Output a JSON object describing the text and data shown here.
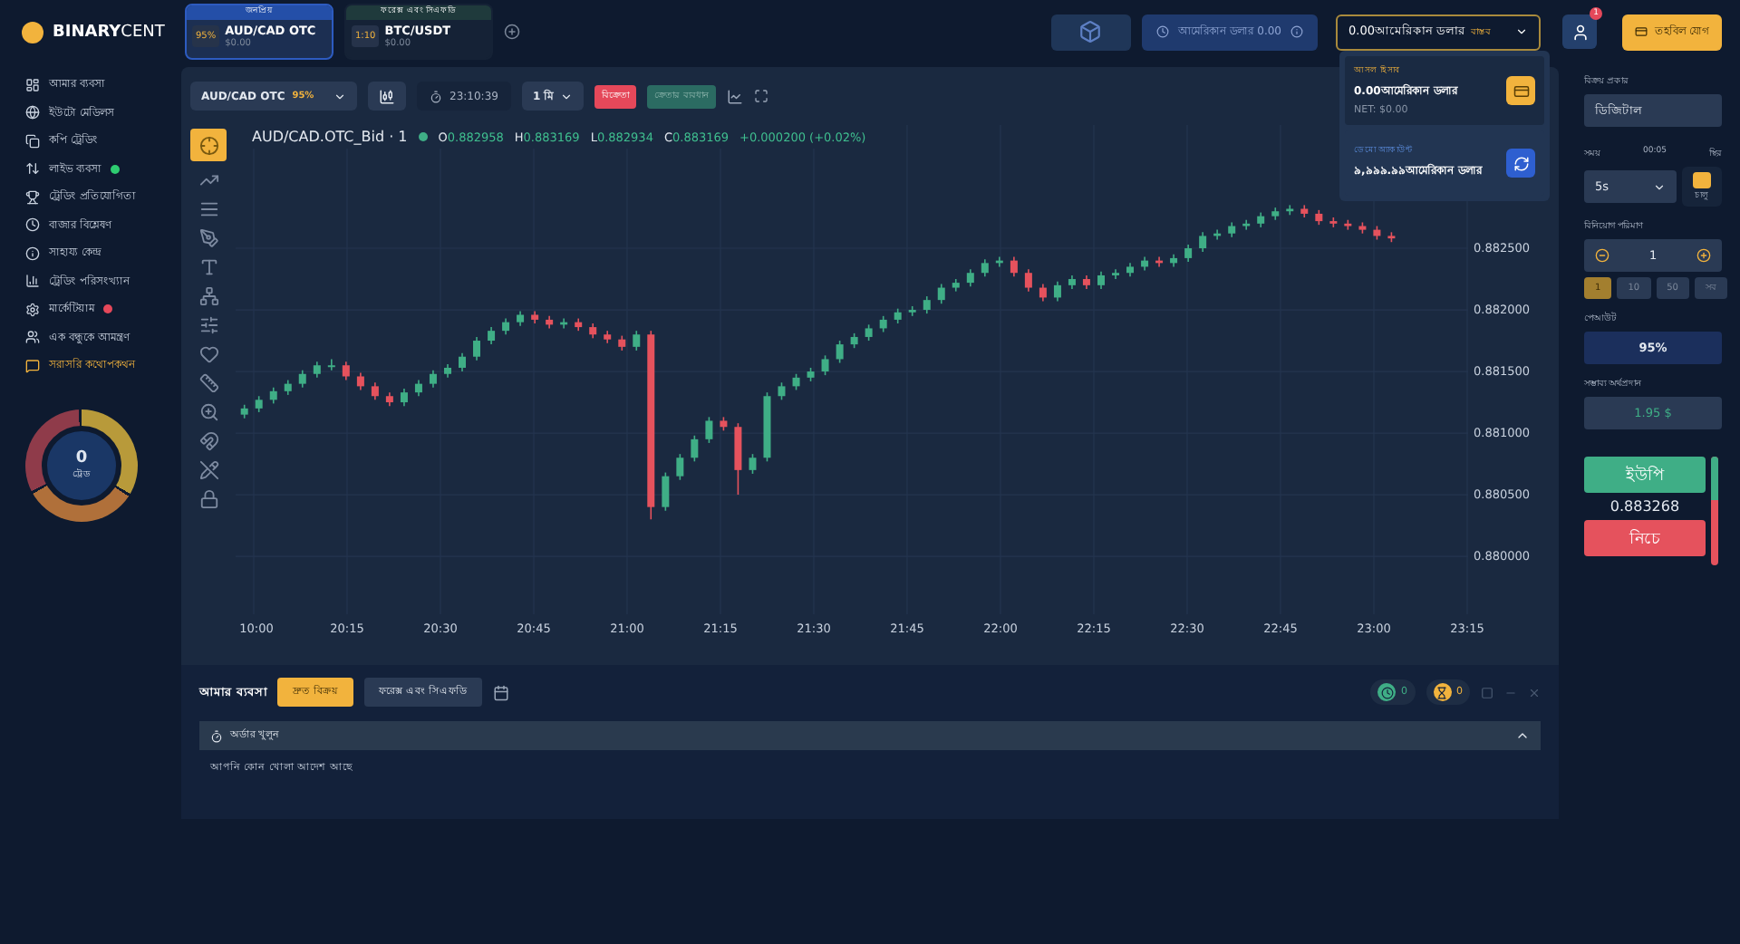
{
  "brand": {
    "bold": "BINARY",
    "light": "CENT"
  },
  "asset_tabs": [
    {
      "heading": "জনপ্রিয়",
      "badge": "95%",
      "symbol": "AUD/CAD OTC",
      "amount": "$0.00",
      "selected": true
    },
    {
      "heading": "ফরেক্স এবং সিএফডি",
      "badge": "1:10",
      "symbol": "BTC/USDT",
      "amount": "$0.00",
      "selected": false
    }
  ],
  "header": {
    "promo_balance": "আমেরিকান ডলার 0.00",
    "account_balance": "0.00আমেরিকান ডলার",
    "account_type": "বাস্তব",
    "notification_count": "1",
    "deposit": "তহবিল যোগ"
  },
  "account_menu": [
    {
      "kind": "real",
      "label": "আসল হিসাব",
      "balance": "0.00আমেরিকান ডলার",
      "net": "NET: $0.00"
    },
    {
      "kind": "demo",
      "label": "ডেমো অ্যাকাউন্ট",
      "balance": "৯,৯৯৯.৯৯আমেরিকান ডলার"
    }
  ],
  "sidebar": {
    "items": [
      {
        "label": "আমার ব্যবসা",
        "selected": false
      },
      {
        "label": "ইউটো মেডিলস",
        "selected": false
      },
      {
        "label": "কপি ট্রেডিং",
        "selected": false
      },
      {
        "label": "লাইভ ব্যবসা",
        "selected": false,
        "color": "#2ecc71"
      },
      {
        "label": "ট্রেডিং প্রতিযোগিতা",
        "selected": false
      },
      {
        "label": "বাজার বিশ্লেষণ",
        "selected": false
      },
      {
        "label": "সাহায্য কেন্দ্র",
        "selected": false
      },
      {
        "label": "ট্রেডিং পরিসংখ্যান",
        "selected": false
      },
      {
        "label": "মার্কেটিয়াম",
        "selected": false,
        "color": "#e5485a"
      },
      {
        "label": "এক বন্ধুকে আমন্ত্রণ",
        "selected": false
      },
      {
        "label": "সরাসরি কথোপকথন",
        "selected": true
      }
    ]
  },
  "wallet": {
    "count": "0",
    "label": "ট্রেড"
  },
  "chart_toolbar": {
    "asset": "AUD/CAD OTC",
    "payout": "95%",
    "time": "23:10:39",
    "interval": "1 মি",
    "sell": "বিক্রেতা",
    "buy": "ক্রেতার ব্যবধান"
  },
  "chart": {
    "title": "AUD/CAD.OTC_Bid · 1",
    "ohlc": [
      {
        "key": "O",
        "value": "0.882958"
      },
      {
        "key": "H",
        "value": "0.883169"
      },
      {
        "key": "L",
        "value": "0.882934"
      },
      {
        "key": "C",
        "value": "0.883169"
      }
    ],
    "change": "+0.000200 (+0.02%)",
    "x_edge_label": "10:00",
    "chart_data": {
      "type": "candlestick",
      "grid": true,
      "ylim": [
        0.87953,
        0.8835
      ],
      "xlim": [
        1197.09,
        1395.15
      ],
      "yticks": [
        {
          "value": 0.8825,
          "label": "0.882500"
        },
        {
          "value": 0.882,
          "label": "0.882000"
        },
        {
          "value": 0.8815,
          "label": "0.881500"
        },
        {
          "value": 0.881,
          "label": "0.881000"
        },
        {
          "value": 0.8805,
          "label": "0.880500"
        },
        {
          "value": 0.88,
          "label": "0.880000"
        }
      ],
      "xticks": [
        {
          "value": 1215,
          "label": "20:15"
        },
        {
          "value": 1230,
          "label": "20:30"
        },
        {
          "value": 1245,
          "label": "20:45"
        },
        {
          "value": 1260,
          "label": "21:00"
        },
        {
          "value": 1275,
          "label": "21:15"
        },
        {
          "value": 1290,
          "label": "21:30"
        },
        {
          "value": 1305,
          "label": "21:45"
        },
        {
          "value": 1320,
          "label": "22:00"
        },
        {
          "value": 1335,
          "label": "22:15"
        },
        {
          "value": 1350,
          "label": "22:30"
        },
        {
          "value": 1365,
          "label": "22:45"
        },
        {
          "value": 1380,
          "label": "23:00"
        },
        {
          "value": 1395,
          "label": "23:15"
        }
      ],
      "x": [
        1198.5,
        1200.83,
        1203.17,
        1205.5,
        1207.83,
        1210.17,
        1212.5,
        1214.83,
        1217.17,
        1219.5,
        1221.83,
        1224.17,
        1226.5,
        1228.83,
        1231.17,
        1233.5,
        1235.83,
        1238.17,
        1240.5,
        1242.83,
        1245.17,
        1247.5,
        1249.83,
        1252.17,
        1254.5,
        1256.83,
        1259.17,
        1261.5,
        1263.83,
        1266.17,
        1268.5,
        1270.83,
        1273.17,
        1275.5,
        1277.83,
        1280.17,
        1282.5,
        1284.83,
        1287.17,
        1289.5,
        1291.83,
        1294.17,
        1296.5,
        1298.83,
        1301.17,
        1303.5,
        1305.83,
        1308.17,
        1310.5,
        1312.83,
        1315.17,
        1317.5,
        1319.83,
        1322.17,
        1324.5,
        1326.83,
        1329.17,
        1331.5,
        1333.83,
        1336.17,
        1338.5,
        1340.83,
        1343.17,
        1345.5,
        1347.83,
        1350.17,
        1352.5,
        1354.83,
        1357.17,
        1359.5,
        1361.83,
        1364.17,
        1366.5,
        1368.83,
        1371.17,
        1373.5,
        1375.83,
        1378.17,
        1380.5,
        1382.83
      ],
      "ohlc": [
        [
          0.88115,
          0.88123,
          0.88112,
          0.8812
        ],
        [
          0.8812,
          0.8813,
          0.88117,
          0.88127
        ],
        [
          0.88127,
          0.88137,
          0.88124,
          0.88134
        ],
        [
          0.88134,
          0.88143,
          0.88131,
          0.8814
        ],
        [
          0.8814,
          0.88151,
          0.88137,
          0.88148
        ],
        [
          0.88148,
          0.88158,
          0.88145,
          0.88155
        ],
        [
          0.88155,
          0.8816,
          0.88151,
          0.88155
        ],
        [
          0.88155,
          0.88158,
          0.88143,
          0.88146
        ],
        [
          0.88146,
          0.88149,
          0.88135,
          0.88138
        ],
        [
          0.88138,
          0.88141,
          0.88127,
          0.8813
        ],
        [
          0.8813,
          0.88133,
          0.88122,
          0.88125
        ],
        [
          0.88125,
          0.88136,
          0.88122,
          0.88133
        ],
        [
          0.88133,
          0.88143,
          0.8813,
          0.8814
        ],
        [
          0.8814,
          0.88151,
          0.88137,
          0.88148
        ],
        [
          0.88148,
          0.88156,
          0.88145,
          0.88153
        ],
        [
          0.88153,
          0.88165,
          0.8815,
          0.88162
        ],
        [
          0.88162,
          0.88178,
          0.88159,
          0.88175
        ],
        [
          0.88175,
          0.88186,
          0.88172,
          0.88183
        ],
        [
          0.88183,
          0.88193,
          0.8818,
          0.8819
        ],
        [
          0.8819,
          0.88199,
          0.88187,
          0.88196
        ],
        [
          0.88196,
          0.88199,
          0.88189,
          0.88192
        ],
        [
          0.88192,
          0.88195,
          0.88185,
          0.88188
        ],
        [
          0.88188,
          0.88193,
          0.88185,
          0.8819
        ],
        [
          0.8819,
          0.88193,
          0.88183,
          0.88186
        ],
        [
          0.88186,
          0.88189,
          0.88177,
          0.8818
        ],
        [
          0.8818,
          0.88183,
          0.88173,
          0.88176
        ],
        [
          0.88176,
          0.88179,
          0.88167,
          0.8817
        ],
        [
          0.8817,
          0.88183,
          0.88167,
          0.8818
        ],
        [
          0.8818,
          0.88183,
          0.8803,
          0.8804
        ],
        [
          0.8804,
          0.88068,
          0.88037,
          0.88065
        ],
        [
          0.88065,
          0.88083,
          0.88062,
          0.8808
        ],
        [
          0.8808,
          0.88098,
          0.88077,
          0.88095
        ],
        [
          0.88095,
          0.88113,
          0.88092,
          0.8811
        ],
        [
          0.8811,
          0.88113,
          0.88102,
          0.88105
        ],
        [
          0.88105,
          0.88108,
          0.8805,
          0.8807
        ],
        [
          0.8807,
          0.88083,
          0.88067,
          0.8808
        ],
        [
          0.8808,
          0.88133,
          0.88077,
          0.8813
        ],
        [
          0.8813,
          0.88141,
          0.88127,
          0.88138
        ],
        [
          0.88138,
          0.88148,
          0.88135,
          0.88145
        ],
        [
          0.88145,
          0.88153,
          0.88142,
          0.8815
        ],
        [
          0.8815,
          0.88163,
          0.88147,
          0.8816
        ],
        [
          0.8816,
          0.88175,
          0.88157,
          0.88172
        ],
        [
          0.88172,
          0.88181,
          0.88169,
          0.88178
        ],
        [
          0.88178,
          0.88188,
          0.88175,
          0.88185
        ],
        [
          0.88185,
          0.88195,
          0.88182,
          0.88192
        ],
        [
          0.88192,
          0.88201,
          0.88189,
          0.88198
        ],
        [
          0.88198,
          0.88203,
          0.88195,
          0.882
        ],
        [
          0.882,
          0.88211,
          0.88197,
          0.88208
        ],
        [
          0.88208,
          0.88221,
          0.88205,
          0.88218
        ],
        [
          0.88218,
          0.88225,
          0.88215,
          0.88222
        ],
        [
          0.88222,
          0.88233,
          0.88219,
          0.8823
        ],
        [
          0.8823,
          0.88241,
          0.88227,
          0.88238
        ],
        [
          0.88238,
          0.88243,
          0.88235,
          0.8824
        ],
        [
          0.8824,
          0.88243,
          0.88227,
          0.8823
        ],
        [
          0.8823,
          0.88233,
          0.88215,
          0.88218
        ],
        [
          0.88218,
          0.88221,
          0.88207,
          0.8821
        ],
        [
          0.8821,
          0.88223,
          0.88207,
          0.8822
        ],
        [
          0.8822,
          0.88228,
          0.88217,
          0.88225
        ],
        [
          0.88225,
          0.88228,
          0.88217,
          0.8822
        ],
        [
          0.8822,
          0.88231,
          0.88217,
          0.88228
        ],
        [
          0.88228,
          0.88233,
          0.88225,
          0.8823
        ],
        [
          0.8823,
          0.88238,
          0.88227,
          0.88235
        ],
        [
          0.88235,
          0.88243,
          0.88232,
          0.8824
        ],
        [
          0.8824,
          0.88243,
          0.88235,
          0.88238
        ],
        [
          0.88238,
          0.88245,
          0.88235,
          0.88242
        ],
        [
          0.88242,
          0.88253,
          0.88239,
          0.8825
        ],
        [
          0.8825,
          0.88263,
          0.88247,
          0.8826
        ],
        [
          0.8826,
          0.88265,
          0.88257,
          0.88262
        ],
        [
          0.88262,
          0.88271,
          0.88259,
          0.88268
        ],
        [
          0.88268,
          0.88273,
          0.88265,
          0.8827
        ],
        [
          0.8827,
          0.88279,
          0.88267,
          0.88276
        ],
        [
          0.88276,
          0.88283,
          0.88273,
          0.8828
        ],
        [
          0.8828,
          0.88285,
          0.88277,
          0.88282
        ],
        [
          0.88282,
          0.88285,
          0.88275,
          0.88278
        ],
        [
          0.88278,
          0.88281,
          0.88269,
          0.88272
        ],
        [
          0.88272,
          0.88275,
          0.88267,
          0.8827
        ],
        [
          0.8827,
          0.88273,
          0.88265,
          0.88268
        ],
        [
          0.88268,
          0.88271,
          0.88262,
          0.88265
        ],
        [
          0.88265,
          0.88268,
          0.88257,
          0.8826
        ],
        [
          0.8826,
          0.88263,
          0.88255,
          0.88258
        ]
      ]
    }
  },
  "trade_panel": {
    "type_label": "বিক্রয় প্রকার",
    "type_value": "ডিজিটাল",
    "time_label": "সময়",
    "countdown": "00:05",
    "fixed_label": "স্থির",
    "duration": "5s",
    "fixed_on": true,
    "fixed_state": "চালু",
    "amount_label": "বিনিয়োগ পরিমাণ",
    "amount": "1",
    "presets": [
      {
        "label": "1",
        "selected": true
      },
      {
        "label": "10",
        "selected": false
      },
      {
        "label": "50",
        "selected": false
      },
      {
        "label": "সব",
        "selected": false
      }
    ],
    "payout_label": "পেআউট",
    "payout": "95%",
    "profit_label": "সম্ভাব্য অর্থপ্রদান",
    "profit": "1.95 $",
    "up": "ইউপি",
    "price": "0.883268",
    "down": "নিচে",
    "sentiment": {
      "level": 0.4
    }
  },
  "trades": {
    "title": "আমার ব্যবসা",
    "tabs": [
      {
        "label": "দ্রুত বিক্রয়",
        "selected": true
      },
      {
        "label": "ফরেক্স এবং সিএফডি",
        "selected": false
      }
    ],
    "counters": [
      {
        "kind": "open",
        "value": "0"
      },
      {
        "kind": "pending",
        "value": "0"
      }
    ],
    "section": {
      "title": "অর্ডার খুলুন",
      "expanded": true
    },
    "empty_text": "আপনি কোন খোলা আদেশ আছে"
  }
}
